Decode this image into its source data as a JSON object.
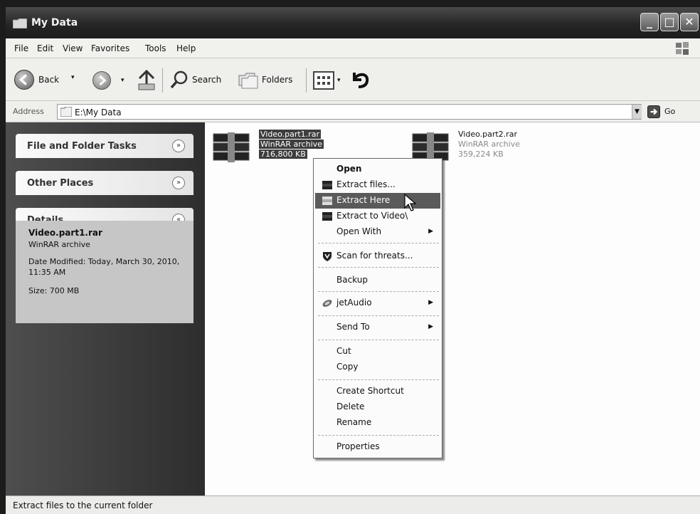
{
  "window": {
    "title": "My Data"
  },
  "menu": [
    "File",
    "Edit",
    "View",
    "Favorites",
    "Tools",
    "Help"
  ],
  "toolbar": {
    "back": "Back",
    "search": "Search",
    "folders": "Folders"
  },
  "address": {
    "label": "Address",
    "value": "E:\\My Data",
    "go": "Go"
  },
  "tasks": {
    "file_folder": "File and Folder Tasks",
    "other_places": "Other Places",
    "details": "Details"
  },
  "details": {
    "name": "Video.part1.rar",
    "type": "WinRAR archive",
    "modified": "Date Modified: Today, March 30, 2010, 11:35 AM",
    "size": "Size: 700 MB"
  },
  "files": [
    {
      "name": "Video.part1.rar",
      "type": "WinRAR archive",
      "size": "716,800 KB",
      "selected": true
    },
    {
      "name": "Video.part2.rar",
      "type": "WinRAR archive",
      "size": "359,224 KB",
      "selected": false
    }
  ],
  "context_menu": {
    "open": "Open",
    "extract_files": "Extract files...",
    "extract_here": "Extract Here",
    "extract_to": "Extract to Video\\",
    "open_with": "Open With",
    "scan": "Scan for threats...",
    "backup": "Backup",
    "jetaudio": "jetAudio",
    "send_to": "Send To",
    "cut": "Cut",
    "copy": "Copy",
    "create_shortcut": "Create Shortcut",
    "delete": "Delete",
    "rename": "Rename",
    "properties": "Properties"
  },
  "status": "Extract files to the current folder",
  "icons": {
    "title": "folder-icon",
    "back": "back-arrow-icon",
    "forward": "forward-arrow-icon",
    "up": "up-folder-icon",
    "search": "search-icon",
    "folders": "folders-icon",
    "views": "views-icon",
    "undo": "undo-icon",
    "address": "folder-icon",
    "go": "go-arrow-icon",
    "rar": "winrar-archive-icon",
    "scan": "shield-icon",
    "jetaudio": "jetaudio-icon",
    "cursor": "mouse-pointer-icon"
  },
  "colors": {
    "titlebar": "#262626",
    "selection": "#3e3e3e",
    "menu_highlight": "#5a5a5a",
    "task_pane": "#3a3a3a"
  }
}
